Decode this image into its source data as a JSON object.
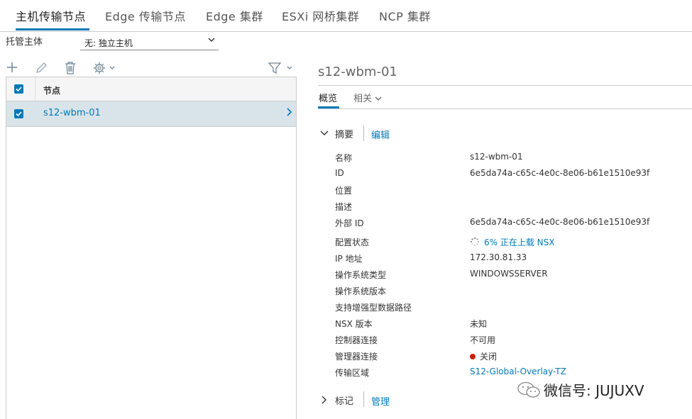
{
  "tabs": [
    {
      "label": "主机传输节点"
    },
    {
      "label": "Edge 传输节点"
    },
    {
      "label": "Edge 集群"
    },
    {
      "label": "ESXi 网桥集群"
    },
    {
      "label": "NCP 集群"
    }
  ],
  "host_filter": {
    "label": "托管主体",
    "selected": "无: 独立主机"
  },
  "grid": {
    "column_header": "节点",
    "rows": [
      {
        "name": "s12-wbm-01",
        "selected": true
      }
    ]
  },
  "detail": {
    "title": "s12-wbm-01",
    "subtabs": [
      {
        "label": "概览"
      },
      {
        "label": "相关"
      }
    ],
    "summary": {
      "heading": "摘要",
      "edit_label": "编辑",
      "props": [
        {
          "label": "名称",
          "value": "s12-wbm-01"
        },
        {
          "label": "ID",
          "value": "6e5da74a-c65c-4e0c-8e06-b61e1510e93f"
        },
        {
          "label": "位置",
          "value": ""
        },
        {
          "label": "描述",
          "value": ""
        },
        {
          "label": "外部 ID",
          "value": "6e5da74a-c65c-4e0c-8e06-b61e1510e93f"
        },
        {
          "label": "配置状态",
          "value": "6% 正在上载 NSX"
        },
        {
          "label": "IP 地址",
          "value": "172.30.81.33"
        },
        {
          "label": "操作系统类型",
          "value": "WINDOWSSERVER"
        },
        {
          "label": "操作系统版本",
          "value": ""
        },
        {
          "label": "支持增强型数据路径",
          "value": ""
        },
        {
          "label": "NSX 版本",
          "value": "未知"
        },
        {
          "label": "控制器连接",
          "value": "不可用"
        },
        {
          "label": "管理器连接",
          "value": "关闭"
        },
        {
          "label": "传输区域",
          "value": "S12-Global-Overlay-TZ"
        }
      ]
    },
    "tags": {
      "heading": "标记",
      "manage_label": "管理"
    }
  },
  "watermark": "微信号: JUJUXV",
  "colors": {
    "accent": "#0079b8",
    "selected_row": "#d9e4ea",
    "status_red": "#c92100"
  }
}
